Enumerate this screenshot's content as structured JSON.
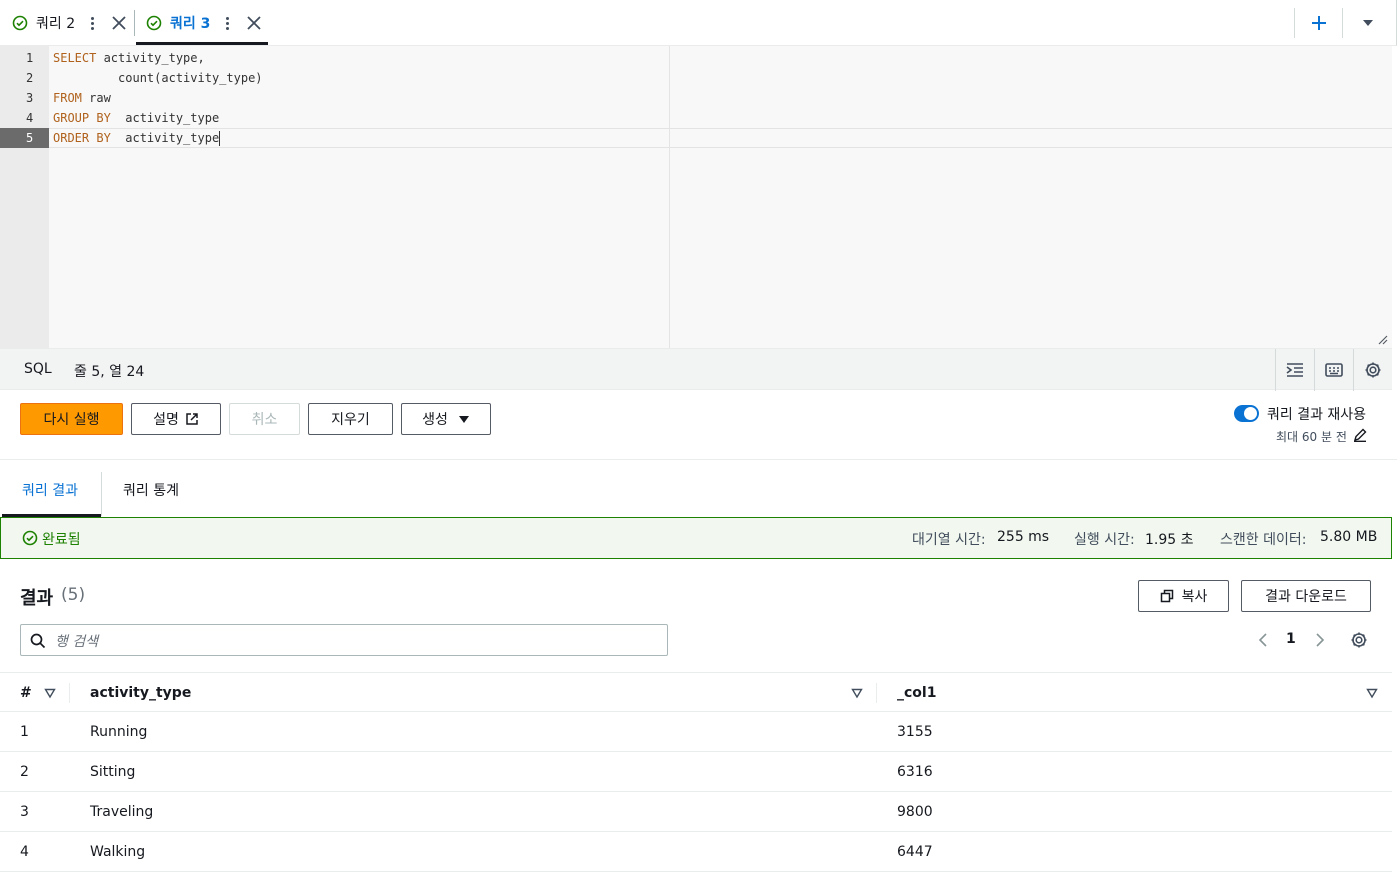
{
  "tabs": [
    {
      "label": "쿼리 2",
      "active": false
    },
    {
      "label": "쿼리 3",
      "active": true
    }
  ],
  "editor": {
    "lines": [
      {
        "num": "1",
        "kw": "SELECT",
        "rest": " activity_type,"
      },
      {
        "num": "2",
        "kw": "",
        "rest": "         count(activity_type)"
      },
      {
        "num": "3",
        "kw": "FROM",
        "rest": " raw"
      },
      {
        "num": "4",
        "kw": "GROUP BY",
        "rest": "  activity_type"
      },
      {
        "num": "5",
        "kw": "ORDER BY",
        "rest": "  activity_type"
      }
    ]
  },
  "statusbar": {
    "language": "SQL",
    "cursor": "줄 5, 열 24"
  },
  "actions": {
    "rerun": "다시 실행",
    "explain": "설명",
    "cancel": "취소",
    "clear": "지우기",
    "generate": "생성",
    "reuse_label": "쿼리 결과 재사용",
    "reuse_sub": "최대 60 분 전"
  },
  "result_tabs": {
    "results": "쿼리 결과",
    "stats": "쿼리 통계"
  },
  "banner": {
    "status": "완료됨",
    "queue_label": "대기열 시간:",
    "queue_value": "255 ms",
    "exec_label": "실행 시간:",
    "exec_value": "1.95 초",
    "scan_label": "스캔한 데이터:",
    "scan_value": "5.80 MB"
  },
  "results": {
    "title": "결과",
    "count": "(5)",
    "copy": "복사",
    "download": "결과 다운로드",
    "search_placeholder": "행 검색",
    "page": "1",
    "columns": [
      "#",
      "activity_type",
      "_col1"
    ],
    "rows": [
      {
        "n": "1",
        "activity_type": "Running",
        "col1": "3155"
      },
      {
        "n": "2",
        "activity_type": "Sitting",
        "col1": "6316"
      },
      {
        "n": "3",
        "activity_type": "Traveling",
        "col1": "9800"
      },
      {
        "n": "4",
        "activity_type": "Walking",
        "col1": "6447"
      }
    ]
  },
  "colors": {
    "accent": "#0972d3",
    "primary_button": "#ff9900",
    "success": "#1d8102"
  }
}
